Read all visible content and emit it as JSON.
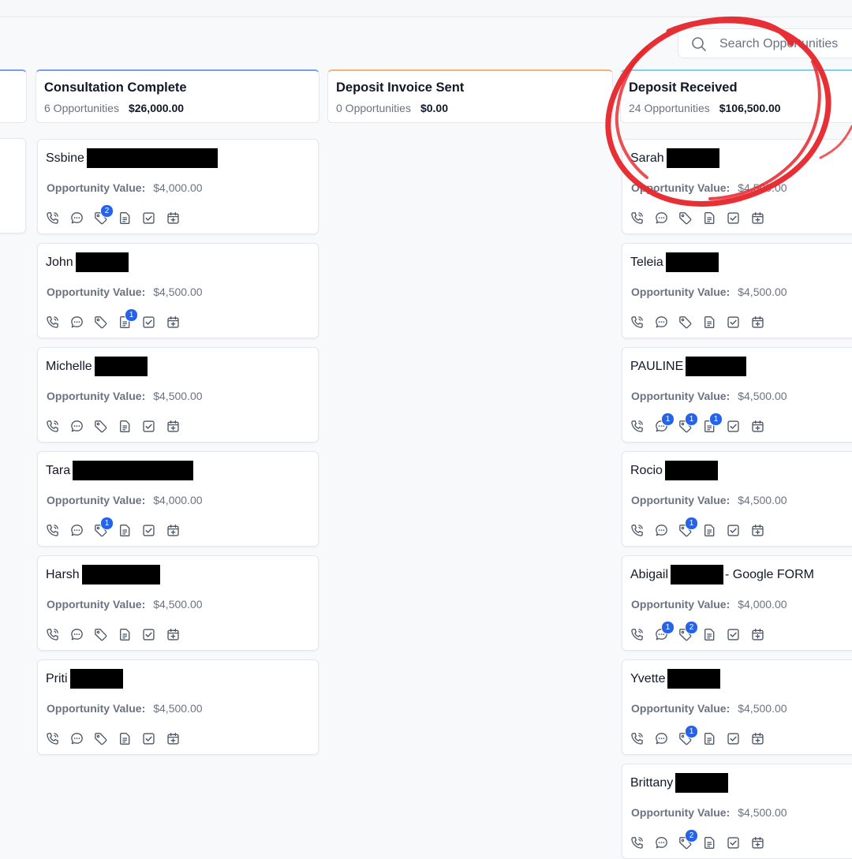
{
  "search": {
    "placeholder": "Search Opportunities"
  },
  "columns": [
    {
      "title": "Consultation Complete",
      "count": "6 Opportunities",
      "amount": "$26,000.00",
      "accent": "#7b9cf5",
      "cards": [
        {
          "name": "Ssbine",
          "redact_w": 166,
          "value_label": "Opportunity Value:",
          "value": "$4,000.00",
          "badges": {
            "tag": "2"
          }
        },
        {
          "name": "John",
          "redact_w": 67,
          "value_label": "Opportunity Value:",
          "value": "$4,500.00",
          "badges": {
            "note": "1"
          }
        },
        {
          "name": "Michelle",
          "redact_w": 67,
          "value_label": "Opportunity Value:",
          "value": "$4,500.00",
          "badges": {}
        },
        {
          "name": "Tara",
          "redact_w": 153,
          "value_label": "Opportunity Value:",
          "value": "$4,000.00",
          "badges": {
            "tag": "1"
          }
        },
        {
          "name": "Harsh",
          "redact_w": 99,
          "value_label": "Opportunity Value:",
          "value": "$4,500.00",
          "badges": {}
        },
        {
          "name": "Priti",
          "redact_w": 67,
          "value_label": "Opportunity Value:",
          "value": "$4,500.00",
          "badges": {}
        }
      ]
    },
    {
      "title": "Deposit Invoice Sent",
      "count": "0 Opportunities",
      "amount": "$0.00",
      "accent": "#f7b27a",
      "cards": []
    },
    {
      "title": "Deposit Received",
      "count": "24 Opportunities",
      "amount": "$106,500.00",
      "accent": "#7fd0ef",
      "cards": [
        {
          "name": "Sarah",
          "redact_w": 67,
          "value_label": "Opportunity Value:",
          "value": "$4,500.00",
          "badges": {}
        },
        {
          "name": "Teleia",
          "redact_w": 67,
          "value_label": "Opportunity Value:",
          "value": "$4,500.00",
          "badges": {}
        },
        {
          "name": "PAULINE",
          "redact_w": 77,
          "value_label": "Opportunity Value:",
          "value": "$4,500.00",
          "badges": {
            "chat": "1",
            "tag": "1",
            "note": "1"
          }
        },
        {
          "name": "Rocio",
          "redact_w": 67,
          "value_label": "Opportunity Value:",
          "value": "$4,500.00",
          "badges": {
            "tag": "1"
          }
        },
        {
          "name": "Abigail",
          "redact_w": 67,
          "suffix": "- Google FORM",
          "value_label": "Opportunity Value:",
          "value": "$4,000.00",
          "badges": {
            "chat": "1",
            "tag": "2"
          }
        },
        {
          "name": "Yvette",
          "redact_w": 67,
          "value_label": "Opportunity Value:",
          "value": "$4,500.00",
          "badges": {
            "tag": "1"
          }
        },
        {
          "name": "Brittany",
          "redact_w": 67,
          "value_label": "Opportunity Value:",
          "value": "$4,500.00",
          "badges": {
            "tag": "2"
          }
        }
      ]
    }
  ],
  "icons": [
    "phone-icon",
    "chat-icon",
    "tag-icon",
    "note-icon",
    "task-icon",
    "calendar-icon"
  ],
  "colors": {
    "accent_blue": "#2563eb",
    "annotation_red": "#e5252a"
  }
}
